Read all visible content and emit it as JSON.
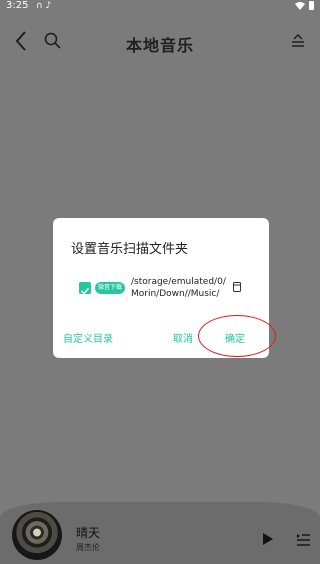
{
  "status_bar": {
    "time": "3:25",
    "notification_icons": "∩ ♪"
  },
  "header": {
    "title": "本地音乐"
  },
  "dialog": {
    "title": "设置音乐扫描文件夹",
    "folder": {
      "tag": "微音下载",
      "path_line1": "/storage/emulated/0/",
      "path_line2": "Morin/Down//Music/",
      "checked": true
    },
    "buttons": {
      "custom": "自定义目录",
      "cancel": "取消",
      "confirm": "确定"
    }
  },
  "player": {
    "song": "晴天",
    "artist": "周杰伦"
  },
  "colors": {
    "accent": "#26c6a1",
    "highlight": "#e02020",
    "overlay": "#7b7b7b"
  }
}
